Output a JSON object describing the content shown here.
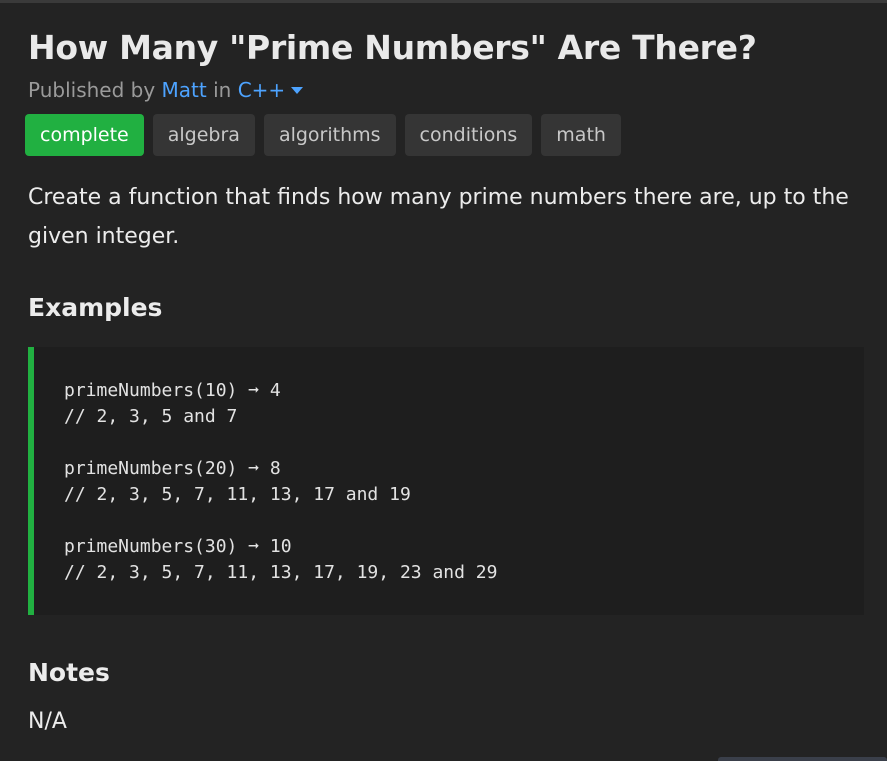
{
  "challenge": {
    "title": "How Many \"Prime Numbers\" Are There?",
    "meta": {
      "published_by_label": "Published by",
      "author": "Matt",
      "in_label": "in",
      "language": "C++"
    },
    "tags": [
      {
        "label": "complete"
      },
      {
        "label": "algebra"
      },
      {
        "label": "algorithms"
      },
      {
        "label": "conditions"
      },
      {
        "label": "math"
      }
    ],
    "description": "Create a function that finds how many prime numbers there are, up to the given integer.",
    "examples": {
      "heading": "Examples",
      "items": [
        {
          "call": "primeNumbers(10) ➞ 4",
          "comment": "// 2, 3, 5 and 7"
        },
        {
          "call": "primeNumbers(20) ➞ 8",
          "comment": "// 2, 3, 5, 7, 11, 13, 17 and 19"
        },
        {
          "call": "primeNumbers(30) ➞ 10",
          "comment": "// 2, 3, 5, 7, 11, 13, 17, 19, 23 and 29"
        }
      ]
    },
    "notes": {
      "heading": "Notes",
      "text": "N/A"
    }
  },
  "colors": {
    "background": "#232323",
    "accent_green": "#21b041",
    "link_blue": "#4da3ff",
    "tag_background": "#353535",
    "code_background": "#1e1e1e"
  },
  "icons": {
    "language_dropdown": "caret-down-icon"
  }
}
